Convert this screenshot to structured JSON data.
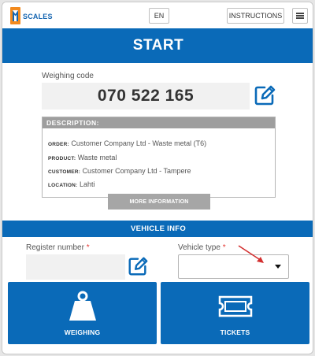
{
  "header": {
    "logo_text": "SCALES",
    "language_label": "EN",
    "instructions_label": "INSTRUCTIONS",
    "menu_icon": "hamburger-menu-icon"
  },
  "start": {
    "title": "START"
  },
  "weighing": {
    "code_label": "Weighing code",
    "code_value": "070 522 165",
    "edit_icon": "edit-icon"
  },
  "description": {
    "header": "DESCRIPTION:",
    "order_key": "ORDER:",
    "order_value": "Customer Company Ltd - Waste metal (T6)",
    "product_key": "PRODUCT:",
    "product_value": "Waste metal",
    "customer_key": "CUSTOMER:",
    "customer_value": "Customer Company Ltd - Tampere",
    "location_key": "LOCATION:",
    "location_value": "Lahti",
    "more_label": "MORE INFORMATION"
  },
  "vehicle": {
    "bar_title": "VEHICLE INFO",
    "register_label": "Register number",
    "register_value": "",
    "type_label": "Vehicle type",
    "type_value": "",
    "required_mark": "*"
  },
  "tiles": {
    "weighing_label": "WEIGHING",
    "weighing_icon": "weight-icon",
    "tickets_label": "TICKETS",
    "tickets_icon": "ticket-icon"
  },
  "colors": {
    "brand_blue": "#0a6ab8",
    "logo_orange": "#f28a1e",
    "required_red": "#e53935",
    "annotation_arrow": "#d32f2f"
  }
}
